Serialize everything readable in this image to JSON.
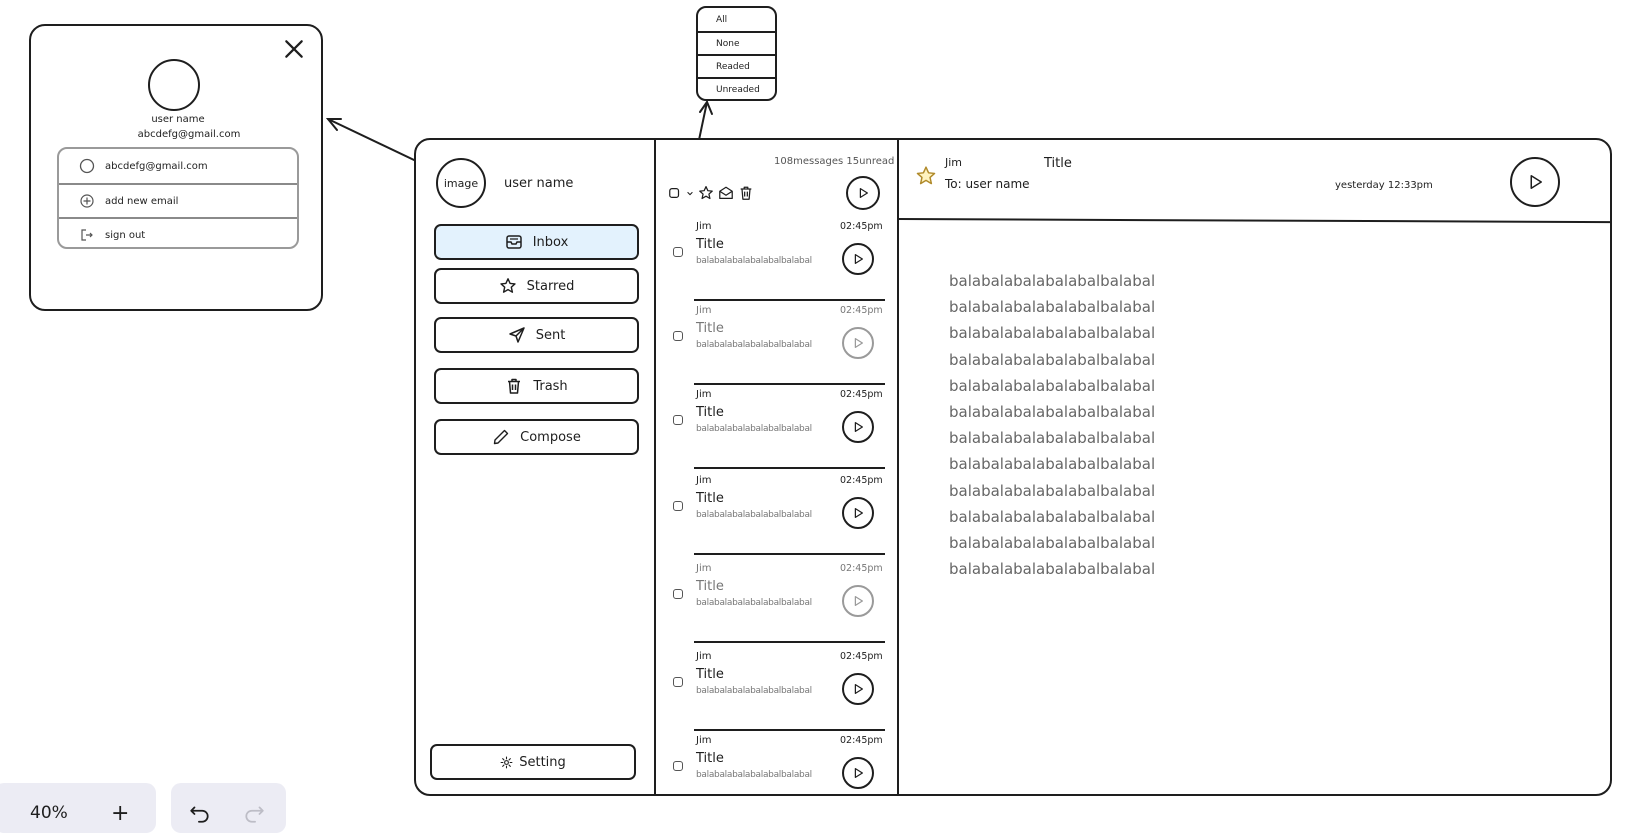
{
  "profile_popup": {
    "user_name": "user name",
    "email": "abcdefg@gmail.com",
    "accounts": [
      {
        "label": "abcdefg@gmail.com",
        "icon": "circle-icon"
      },
      {
        "label": "add new email",
        "icon": "plus-circle-icon"
      },
      {
        "label": "sign out",
        "icon": "sign-out-icon"
      }
    ]
  },
  "filter_dropdown": {
    "options": [
      "All",
      "None",
      "Readed",
      "Unreaded"
    ]
  },
  "sidebar": {
    "avatar_text": "image",
    "user_name": "user name",
    "nav": [
      {
        "label": "Inbox",
        "icon": "inbox-icon",
        "active": true
      },
      {
        "label": "Starred",
        "icon": "star-icon",
        "active": false
      },
      {
        "label": "Sent",
        "icon": "send-icon",
        "active": false
      },
      {
        "label": "Trash",
        "icon": "trash-icon",
        "active": false
      },
      {
        "label": "Compose",
        "icon": "pencil-icon",
        "active": false
      }
    ],
    "setting_label": "Setting"
  },
  "message_list": {
    "count_text": "108messages 15unread",
    "items": [
      {
        "sender": "Jim",
        "time": "02:45pm",
        "title": "Title",
        "preview": "balabalabalabalabalbalabal",
        "read": false
      },
      {
        "sender": "Jim",
        "time": "02:45pm",
        "title": "Title",
        "preview": "balabalabalabalabalbalabal",
        "read": true
      },
      {
        "sender": "Jim",
        "time": "02:45pm",
        "title": "Title",
        "preview": "balabalabalabalabalbalabal",
        "read": false
      },
      {
        "sender": "Jim",
        "time": "02:45pm",
        "title": "Title",
        "preview": "balabalabalabalabalbalabal",
        "read": false
      },
      {
        "sender": "Jim",
        "time": "02:45pm",
        "title": "Title",
        "preview": "balabalabalabalabalbalabal",
        "read": true
      },
      {
        "sender": "Jim",
        "time": "02:45pm",
        "title": "Title",
        "preview": "balabalabalabalabalbalabal",
        "read": false
      },
      {
        "sender": "Jim",
        "time": "02:45pm",
        "title": "Title",
        "preview": "balabalabalabalabalbalabal",
        "read": false
      }
    ]
  },
  "reader": {
    "sender": "Jim",
    "title": "Title",
    "to": "To: user name",
    "date": "yesterday 12:33pm",
    "body_lines": [
      "balabalabalabalabalbalabal",
      "balabalabalabalabalbalabal",
      "balabalabalabalabalbalabal",
      "balabalabalabalabalbalabal",
      "balabalabalabalabalbalabal",
      "balabalabalabalabalbalabal",
      "balabalabalabalabalbalabal",
      "balabalabalabalabalbalabal",
      "balabalabalabalabalbalabal",
      "balabalabalabalabalbalabal",
      "balabalabalabalabalbalabal",
      "balabalabalabalabalbalabal"
    ]
  },
  "toolbar": {
    "zoom": "40%",
    "zoom_in": "+"
  },
  "colors": {
    "active_nav_bg": "#e3f2fd",
    "star_fill": "#fff3bf",
    "toolbar_bg": "#ececf4"
  }
}
